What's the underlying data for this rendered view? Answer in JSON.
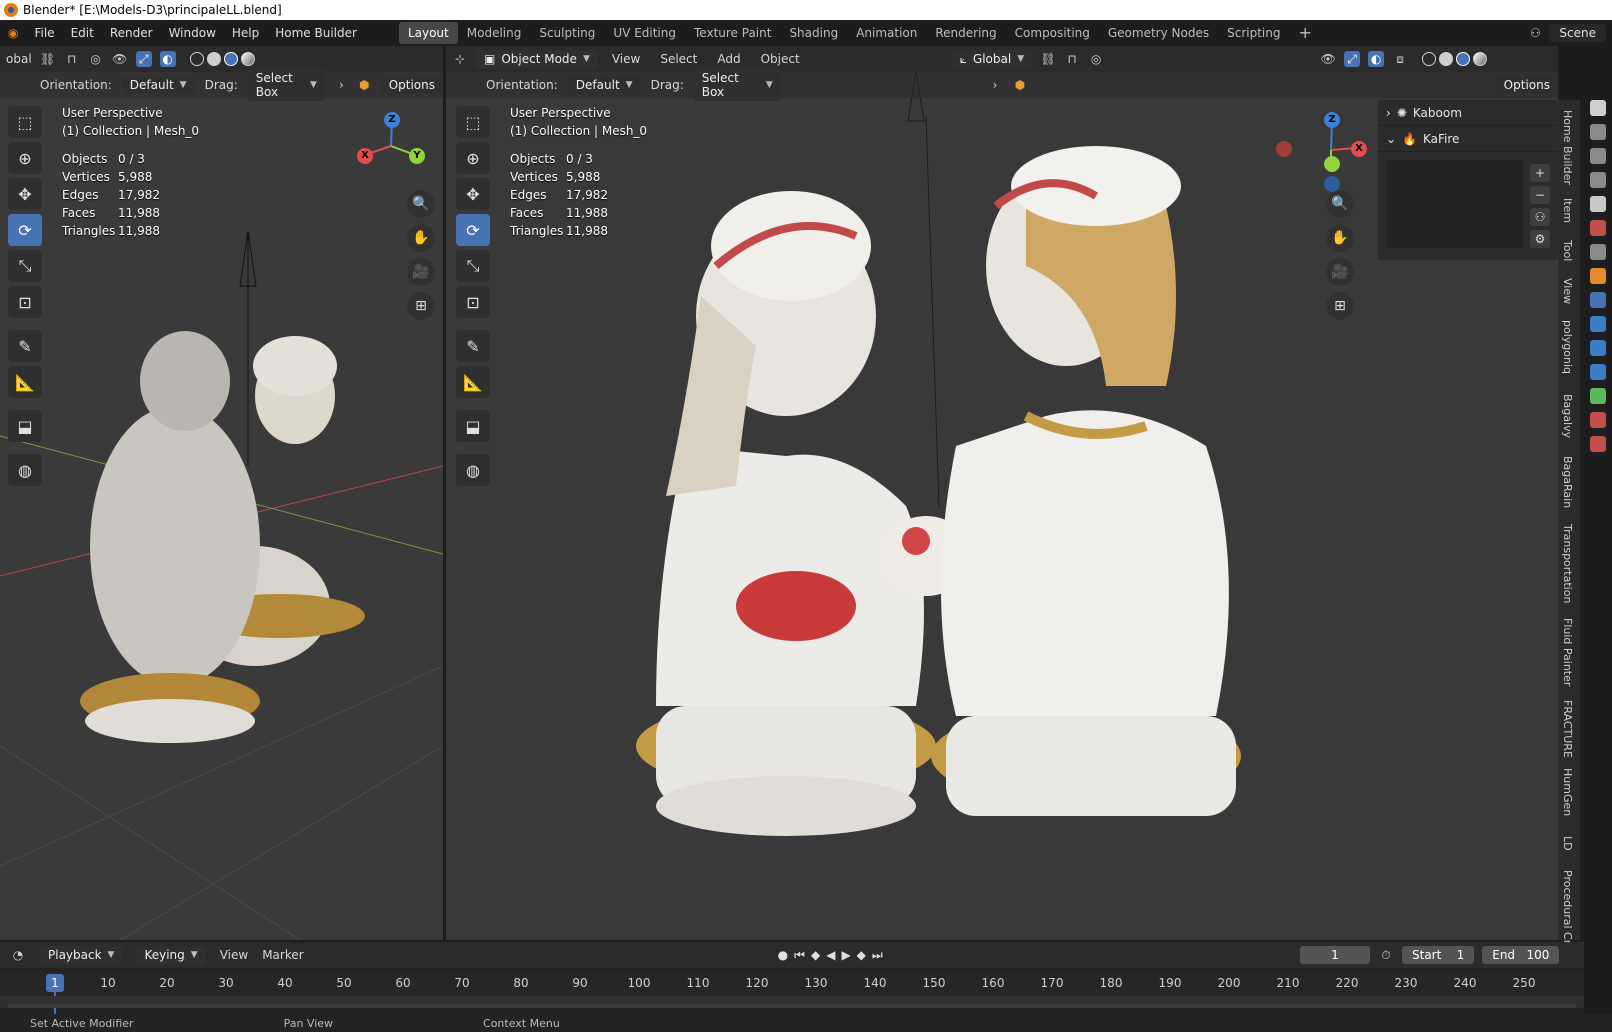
{
  "window": {
    "title": "Blender* [E:\\Models-D3\\principaleLL.blend]"
  },
  "menu": [
    "File",
    "Edit",
    "Render",
    "Window",
    "Help",
    "Home Builder"
  ],
  "workspaces": [
    "Layout",
    "Modeling",
    "Sculpting",
    "UV Editing",
    "Texture Paint",
    "Shading",
    "Animation",
    "Rendering",
    "Compositing",
    "Geometry Nodes",
    "Scripting"
  ],
  "active_workspace": "Layout",
  "scene": {
    "label": "Scene"
  },
  "viewport_left": {
    "transform_label": "obal",
    "orientation_label": "Orientation:",
    "orientation_value": "Default",
    "drag_label": "Drag:",
    "drag_value": "Select Box",
    "options_label": "Options",
    "view_name": "User Perspective",
    "collection": "(1) Collection | Mesh_0",
    "stats": [
      {
        "k": "Objects",
        "v": "0 / 3"
      },
      {
        "k": "Vertices",
        "v": "5,988"
      },
      {
        "k": "Edges",
        "v": "17,982"
      },
      {
        "k": "Faces",
        "v": "11,988"
      },
      {
        "k": "Triangles",
        "v": "11,988"
      }
    ]
  },
  "viewport_right": {
    "mode": "Object Mode",
    "menu": [
      "View",
      "Select",
      "Add",
      "Object"
    ],
    "transform_orientation": "Global",
    "orientation_label": "Orientation:",
    "orientation_value": "Default",
    "drag_label": "Drag:",
    "drag_value": "Select Box",
    "options_label": "Options",
    "view_name": "User Perspective",
    "collection": "(1) Collection | Mesh_0",
    "stats": [
      {
        "k": "Objects",
        "v": "0 / 3"
      },
      {
        "k": "Vertices",
        "v": "5,988"
      },
      {
        "k": "Edges",
        "v": "17,982"
      },
      {
        "k": "Faces",
        "v": "11,988"
      },
      {
        "k": "Triangles",
        "v": "11,988"
      }
    ]
  },
  "n_panel": {
    "items": [
      "Kaboom",
      "KaFire"
    ]
  },
  "side_tabs": [
    "Home Builder",
    "Item",
    "Tool",
    "View",
    "polygoniq",
    "Bagalvy",
    "BagaRain",
    "Transportation",
    "Fluid Painter",
    "FRACTURE",
    "HumGen",
    "LD",
    "Procedural Cro"
  ],
  "timeline": {
    "menu": [
      "Playback",
      "Keying",
      "View",
      "Marker"
    ],
    "current_frame": "1",
    "start_label": "Start",
    "start_value": "1",
    "end_label": "End",
    "end_value": "100",
    "ticks": [
      "10",
      "20",
      "30",
      "40",
      "50",
      "60",
      "70",
      "80",
      "90",
      "100",
      "110",
      "120",
      "130",
      "140",
      "150",
      "160",
      "170",
      "180",
      "190",
      "200",
      "210",
      "220",
      "230",
      "240",
      "250"
    ]
  },
  "status": [
    "Set Active Modifier",
    "Pan View",
    "Context Menu"
  ],
  "colors": {
    "accent": "#4772b3",
    "x_axis": "#e74c4c",
    "y_axis": "#8fd43a",
    "z_axis": "#3b82d6"
  }
}
